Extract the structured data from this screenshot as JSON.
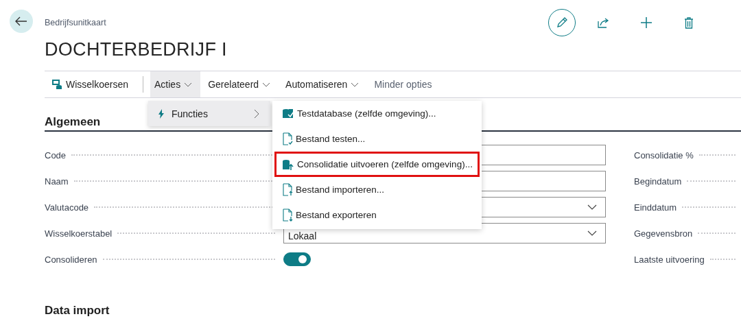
{
  "header": {
    "breadcrumb": "Bedrijfsunitkaart",
    "title": "DOCHTERBEDRIJF I"
  },
  "actions": [
    {
      "kind": "edit"
    },
    {
      "kind": "share"
    },
    {
      "kind": "new"
    },
    {
      "kind": "delete"
    }
  ],
  "toolbar": [
    {
      "label": "Wisselkoersen",
      "kind": "icon",
      "selected": false
    },
    {
      "label": "Acties",
      "kind": "dropdown",
      "selected": true
    },
    {
      "label": "Gerelateerd",
      "kind": "dropdown",
      "selected": false
    },
    {
      "label": "Automatiseren",
      "kind": "dropdown",
      "selected": false
    },
    {
      "label": "Minder opties",
      "kind": "plain",
      "selected": false
    }
  ],
  "actions_menu": [
    {
      "label": "Functies",
      "selected": true
    }
  ],
  "functions_menu": [
    {
      "label": "Testdatabase (zelfde omgeving)...",
      "kind": "database-check",
      "highlighted": false
    },
    {
      "label": "Bestand testen...",
      "kind": "file-check",
      "highlighted": false
    },
    {
      "label": "Consolidatie uitvoeren (zelfde omgeving)...",
      "kind": "database-up",
      "highlighted": true
    },
    {
      "label": "Bestand importeren...",
      "kind": "file-up",
      "highlighted": false
    },
    {
      "label": "Bestand exporteren",
      "kind": "file-down",
      "highlighted": false
    }
  ],
  "sections": [
    {
      "title": "Algemeen",
      "fields_left": [
        {
          "label": "Code",
          "kind": "text"
        },
        {
          "label": "Naam",
          "kind": "text"
        },
        {
          "label": "Valutacode",
          "kind": "select"
        },
        {
          "label": "Wisselkoerstabel",
          "kind": "select",
          "value": "Lokaal"
        },
        {
          "label": "Consolideren",
          "kind": "toggle",
          "on": true
        }
      ],
      "fields_right": [
        {
          "label": "Consolidatie %"
        },
        {
          "label": "Begindatum"
        },
        {
          "label": "Einddatum"
        },
        {
          "label": "Gegevensbron"
        },
        {
          "label": "Laatste uitvoering"
        }
      ]
    },
    {
      "title": "Data import"
    }
  ]
}
